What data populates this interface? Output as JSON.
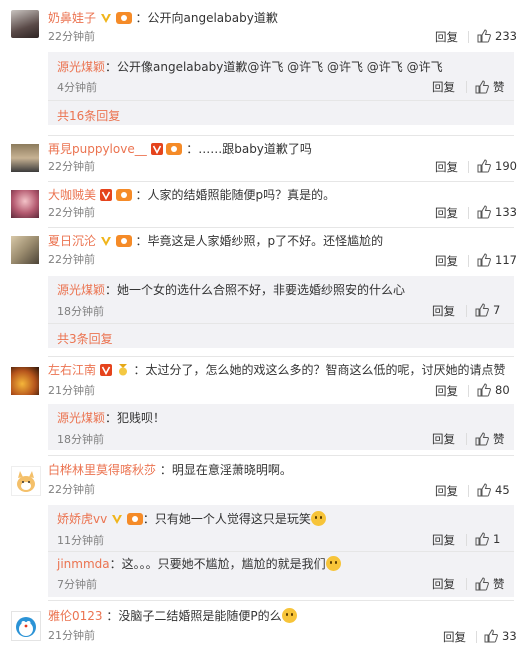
{
  "reply_label": "回复",
  "like_label": "赞",
  "comments": [
    {
      "user": "奶鼻娃子",
      "text": "：公开向angelababy道歉",
      "time": "22分钟前",
      "likes": "233",
      "replies": [
        {
          "user": "源光煤颖",
          "text": "：公开像angelababy道歉@许飞 @许飞 @许飞 @许飞 @许飞",
          "time": "4分钟前"
        }
      ],
      "more": "共16条回复"
    },
    {
      "user": "再見puppylove__",
      "text": "：……跟baby道歉了吗",
      "time": "22分钟前",
      "likes": "190"
    },
    {
      "user": "大咖贼美",
      "text": "：人家的结婚照能随便p吗？真是的。",
      "time": "22分钟前",
      "likes": "133"
    },
    {
      "user": "夏日沉沦",
      "text": "：毕竟这是人家婚纱照，p了不好。还怪尴尬的",
      "time": "22分钟前",
      "likes": "117",
      "replies": [
        {
          "user": "源光煤颖",
          "text": "：她一个女的选什么合照不好，非要选婚纱照安的什么心",
          "time": "18分钟前",
          "likes": "7"
        }
      ],
      "more": "共3条回复"
    },
    {
      "user": "左右江南",
      "text": "：太过分了，怎么她的戏这么多的？智商这么低的呢，讨厌她的请点赞",
      "time": "21分钟前",
      "likes": "80",
      "replies": [
        {
          "user": "源光煤颖",
          "text": "：犯贱呗！",
          "time": "18分钟前"
        }
      ]
    },
    {
      "user": "白桦林里莫得喀秋莎",
      "text": "：明显在意淫萧晓明啊。",
      "time": "22分钟前",
      "likes": "45",
      "replies": [
        {
          "user": "娇娇虎vv",
          "text": "：只有她一个人觉得这只是玩笑",
          "time": "11分钟前",
          "likes": "1"
        },
        {
          "user": "jinmmda",
          "text": "：这。。。只要她不尴尬，尴尬的就是我们",
          "time": "7分钟前"
        }
      ]
    },
    {
      "user": "雅伦0123",
      "text": "：没脑子二结婚照是能随便P的么",
      "time": "21分钟前",
      "likes": "33"
    }
  ]
}
